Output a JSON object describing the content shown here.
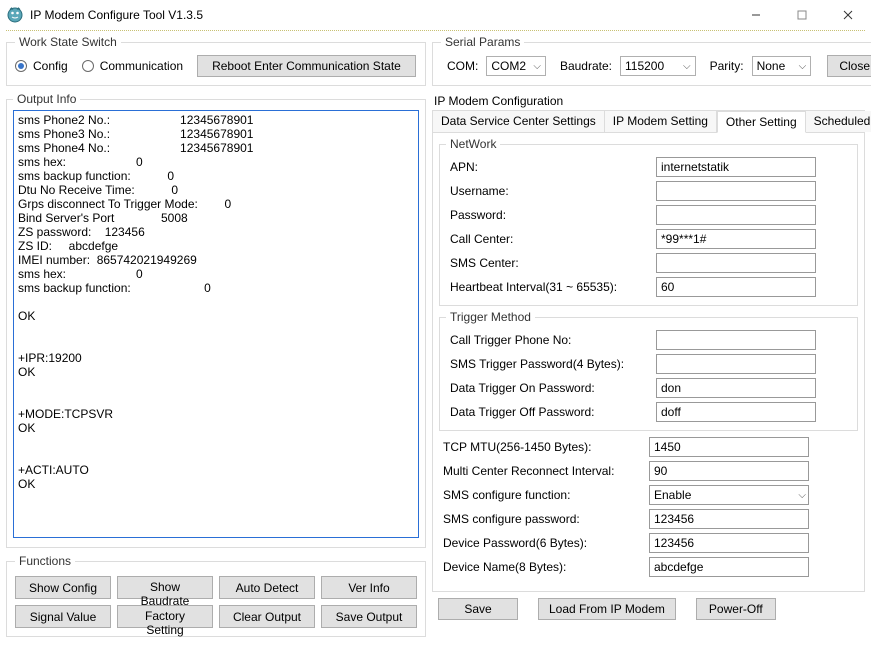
{
  "window": {
    "title": "IP Modem Configure Tool V1.3.5"
  },
  "workstate": {
    "legend": "Work State Switch",
    "config_label": "Config",
    "comm_label": "Communication",
    "reboot_btn": "Reboot Enter Communication State"
  },
  "serial": {
    "legend": "Serial Params",
    "com_label": "COM:",
    "com_value": "COM2",
    "baud_label": "Baudrate:",
    "baud_value": "115200",
    "parity_label": "Parity:",
    "parity_value": "None",
    "close_btn": "Close"
  },
  "output": {
    "legend": "Output Info",
    "text": "sms Phone2 No.:                     12345678901\nsms Phone3 No.:                     12345678901\nsms Phone4 No.:                     12345678901\nsms hex:                     0\nsms backup function:           0\nDtu No Receive Time:           0\nGrps disconnect To Trigger Mode:        0\nBind Server's Port              5008\nZS password:    123456\nZS ID:     abcdefge\nIMEI number:  865742021949269\nsms hex:                     0\nsms backup function:                      0\n\nOK\n\n\n+IPR:19200\nOK\n\n\n+MODE:TCPSVR\nOK\n\n\n+ACTI:AUTO\nOK\n"
  },
  "functions": {
    "legend": "Functions",
    "buttons": [
      "Show Config",
      "Show Baudrate",
      "Auto Detect",
      "Ver Info",
      "Signal Value",
      "Factory Setting",
      "Clear Output",
      "Save Output"
    ]
  },
  "configHeader": "IP Modem Configuration",
  "tabs": {
    "t0": "Data Service Center Settings",
    "t1": "IP Modem Setting",
    "t2": "Other Setting",
    "t3": "Scheduled Pow"
  },
  "network": {
    "legend": "NetWork",
    "apn_l": "APN:",
    "apn_v": "internetstatik",
    "user_l": "Username:",
    "user_v": "",
    "pass_l": "Password:",
    "pass_v": "",
    "call_l": "Call Center:",
    "call_v": "*99***1#",
    "sms_l": "SMS Center:",
    "sms_v": "",
    "hb_l": "Heartbeat Interval(31 ~ 65535):",
    "hb_v": "60"
  },
  "trigger": {
    "legend": "Trigger Method",
    "ctp_l": "Call Trigger Phone No:",
    "ctp_v": "",
    "stp_l": "SMS Trigger Password(4 Bytes):",
    "stp_v": "",
    "don_l": "Data Trigger On Password:",
    "don_v": "don",
    "doff_l": "Data Trigger Off Password:",
    "doff_v": "doff"
  },
  "other": {
    "mtu_l": "TCP MTU(256-1450 Bytes):",
    "mtu_v": "1450",
    "mci_l": "Multi Center Reconnect Interval:",
    "mci_v": "90",
    "scf_l": "SMS configure function:",
    "scf_v": "Enable",
    "scp_l": "SMS configure password:",
    "scp_v": "123456",
    "dpw_l": "Device Password(6 Bytes):",
    "dpw_v": "123456",
    "dnm_l": "Device Name(8 Bytes):",
    "dnm_v": "abcdefge"
  },
  "bottom": {
    "save": "Save",
    "load": "Load From IP Modem",
    "power": "Power-Off"
  }
}
